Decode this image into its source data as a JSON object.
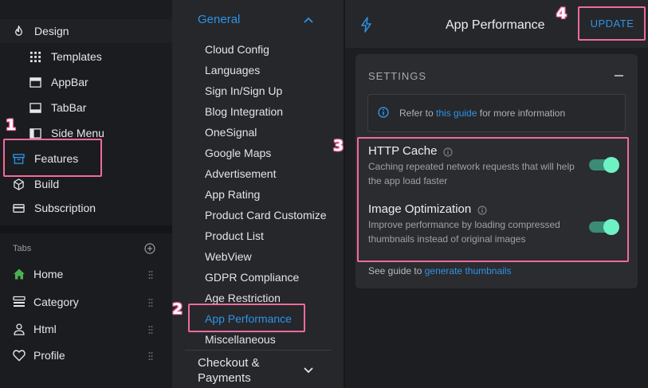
{
  "sidebar": {
    "items": [
      {
        "label": "Design",
        "icon": "flame-icon"
      },
      {
        "label": "Templates",
        "icon": "grid-icon"
      },
      {
        "label": "AppBar",
        "icon": "appbar-icon"
      },
      {
        "label": "TabBar",
        "icon": "tabbar-icon"
      },
      {
        "label": "Side Menu",
        "icon": "sidemenu-icon"
      },
      {
        "label": "Features",
        "icon": "archive-icon"
      },
      {
        "label": "Build",
        "icon": "cube-icon"
      },
      {
        "label": "Subscription",
        "icon": "card-icon"
      }
    ],
    "tabs_header": "Tabs",
    "tabs": [
      {
        "label": "Home",
        "icon": "home-icon"
      },
      {
        "label": "Category",
        "icon": "category-icon"
      },
      {
        "label": "Html",
        "icon": "person-icon"
      },
      {
        "label": "Profile",
        "icon": "heart-icon"
      }
    ]
  },
  "menu": {
    "section": "General",
    "items": [
      "Cloud Config",
      "Languages",
      "Sign In/Sign Up",
      "Blog Integration",
      "OneSignal",
      "Google Maps",
      "Advertisement",
      "App Rating",
      "Product Card Customize",
      "Product List",
      "WebView",
      "GDPR Compliance",
      "Age Restriction",
      "App Performance",
      "Miscellaneous"
    ],
    "active_item": "App Performance",
    "next_section": "Checkout & Payments"
  },
  "header": {
    "title": "App Performance",
    "update_label": "UPDATE"
  },
  "settings": {
    "title": "SETTINGS",
    "info_prefix": "Refer to ",
    "info_link": "this guide",
    "info_suffix": " for more information",
    "options": [
      {
        "title": "HTTP Cache",
        "description": "Caching repeated network requests that will help the app load faster",
        "enabled": true
      },
      {
        "title": "Image Optimization",
        "description": "Improve performance by loading compressed thumbnails instead of original images",
        "enabled": true
      }
    ],
    "guide_prefix": "See guide to ",
    "guide_link": "generate thumbnails"
  },
  "annotations": [
    "1",
    "2",
    "3",
    "4"
  ],
  "colors": {
    "accent": "#2f93e6",
    "highlight": "#f26a9c",
    "toggle_on": "#6ff2c3",
    "home_icon": "#4caf50"
  }
}
